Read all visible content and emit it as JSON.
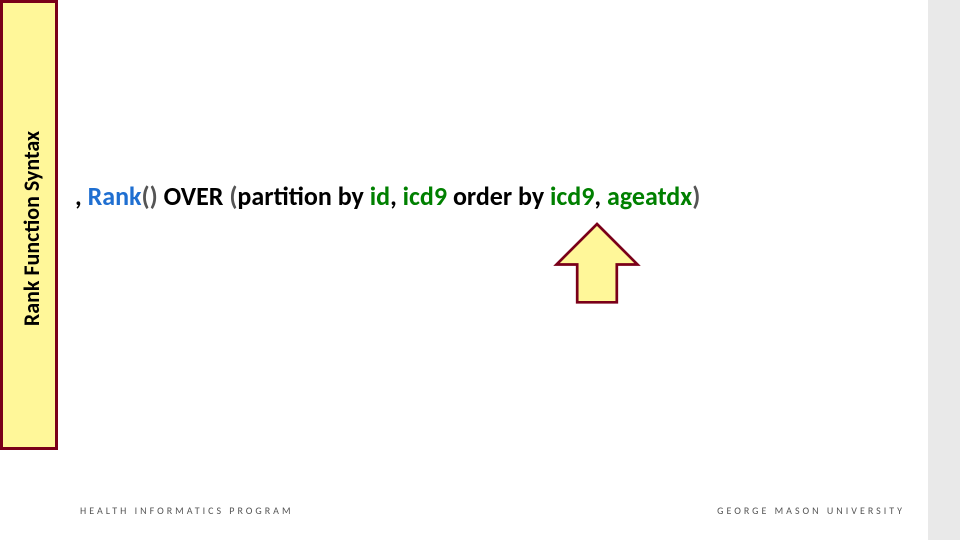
{
  "sidebar": {
    "title": "Rank Function Syntax"
  },
  "syntax": {
    "comma": ", ",
    "fn_name": "Rank",
    "open_paren": "(",
    "close_paren": ")",
    "over": " OVER ",
    "open_paren2": "(",
    "partition_by": "partition by ",
    "col_id": "id",
    "sep1": ", ",
    "col_icd9_a": "icd9",
    "order_by": " order by ",
    "col_icd9_b": "icd9",
    "sep2": ", ",
    "col_age": "ageatdx",
    "close_paren2": ")"
  },
  "footer": {
    "left": "HEALTH INFORMATICS PROGRAM",
    "right": "GEORGE MASON UNIVERSITY"
  },
  "icons": {
    "arrow": "up-arrow-icon"
  },
  "colors": {
    "sidebar_fill": "#fff799",
    "sidebar_border": "#7a0019",
    "fn": "#1f6fd1",
    "col": "#008000",
    "arrow_fill": "#fff799",
    "arrow_stroke": "#7a0019"
  }
}
